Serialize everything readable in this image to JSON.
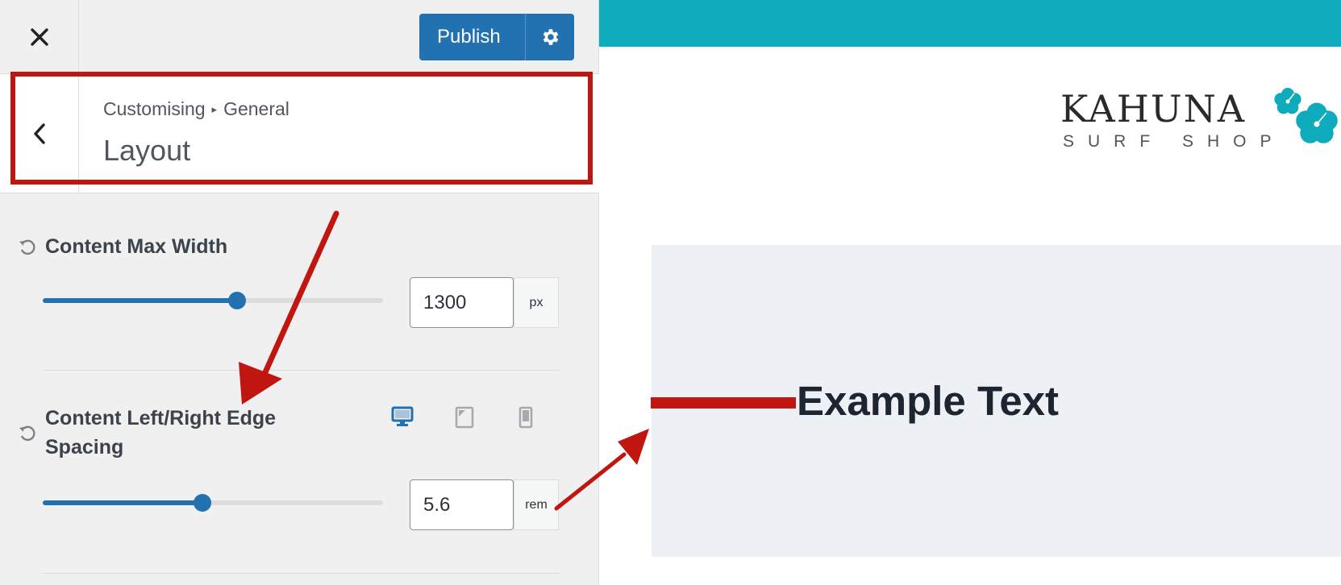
{
  "sidebar": {
    "publish_label": "Publish",
    "breadcrumb": {
      "parent": "Customising",
      "separator": "▸",
      "current": "General"
    },
    "section_title": "Layout",
    "controls": {
      "max_width": {
        "label": "Content Max Width",
        "value": "1300",
        "unit": "px",
        "slider_fraction": 0.57
      },
      "edge_spacing": {
        "label": "Content Left/Right Edge Spacing",
        "value": "5.6",
        "unit": "rem",
        "slider_fraction": 0.47
      }
    },
    "devices": [
      "desktop-icon",
      "tablet-icon",
      "mobile-icon"
    ],
    "active_device": "desktop"
  },
  "preview": {
    "logo": {
      "name": "KAHUNA",
      "tagline": "SURF SHOP"
    },
    "example_text": "Example Text"
  },
  "colors": {
    "accent": "#2271b1",
    "site_header": "#0eabbd",
    "annotation": "#c1150f"
  }
}
